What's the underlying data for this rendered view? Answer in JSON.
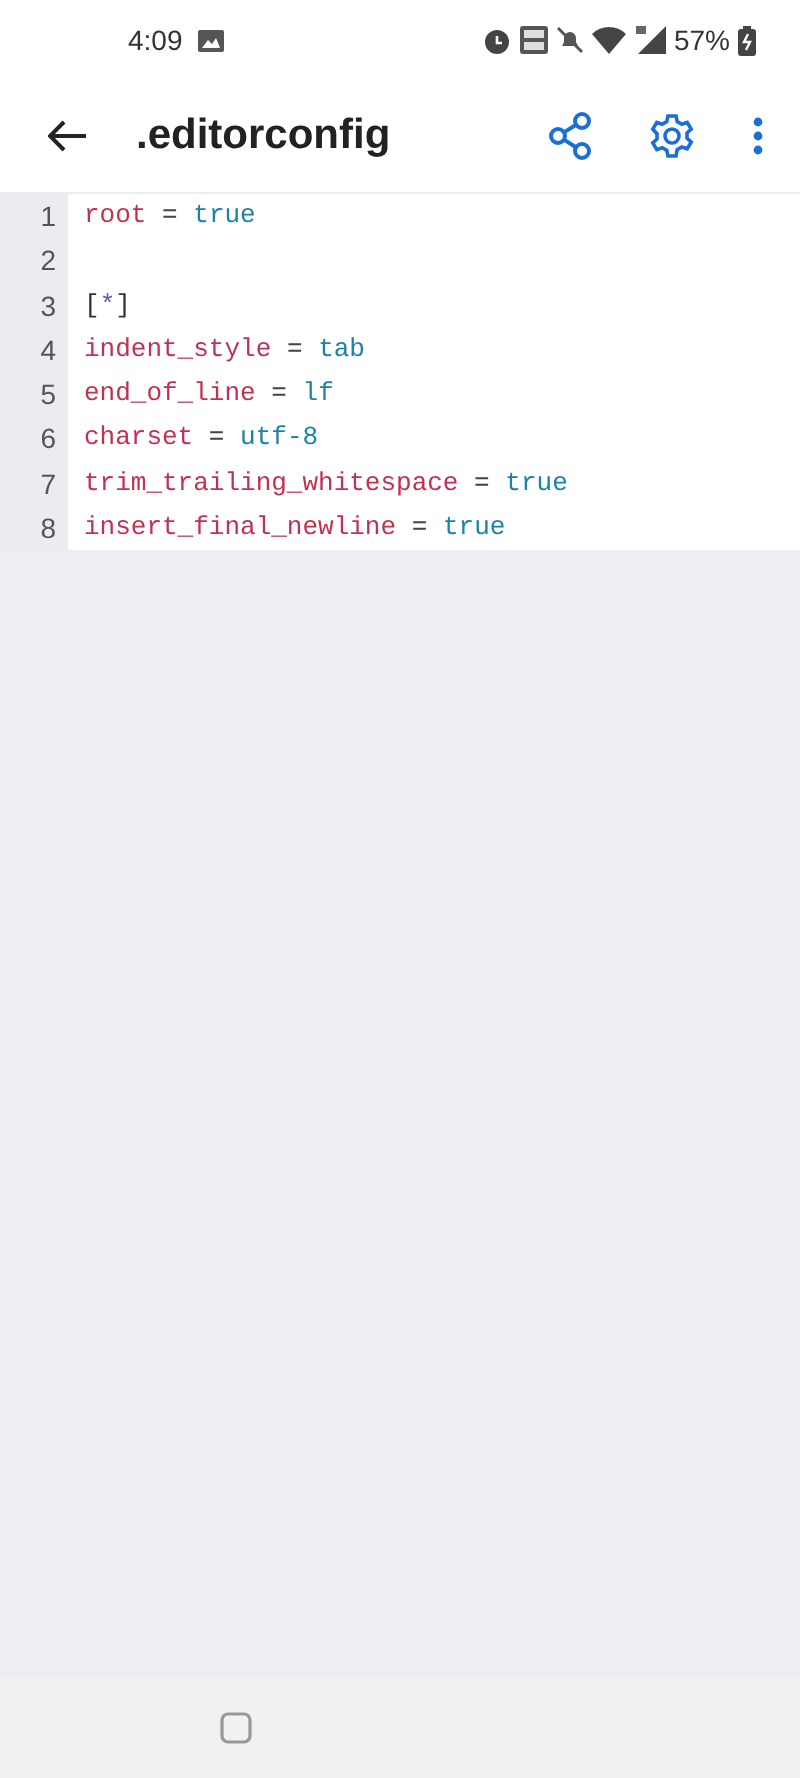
{
  "status_bar": {
    "time": "4:09",
    "battery": "57%"
  },
  "toolbar": {
    "title": ".editorconfig"
  },
  "editor": {
    "lines": [
      {
        "number": "1",
        "tokens": [
          {
            "kind": "key",
            "text": "root"
          },
          {
            "kind": "op",
            "text": "="
          },
          {
            "kind": "value",
            "text": "true"
          }
        ]
      },
      {
        "number": "2"
      },
      {
        "number": "3",
        "tokens": [
          {
            "kind": "bracket",
            "text": "["
          },
          {
            "kind": "glob",
            "text": "*"
          },
          {
            "kind": "bracket",
            "text": "]"
          }
        ]
      },
      {
        "number": "4",
        "tokens": [
          {
            "kind": "key",
            "text": "indent_style"
          },
          {
            "kind": "op",
            "text": "="
          },
          {
            "kind": "value",
            "text": "tab"
          }
        ]
      },
      {
        "number": "5",
        "tokens": [
          {
            "kind": "key",
            "text": "end_of_line"
          },
          {
            "kind": "op",
            "text": "="
          },
          {
            "kind": "value",
            "text": "lf"
          }
        ]
      },
      {
        "number": "6",
        "tokens": [
          {
            "kind": "key",
            "text": "charset"
          },
          {
            "kind": "op",
            "text": "="
          },
          {
            "kind": "value",
            "text": "utf-8"
          }
        ]
      },
      {
        "number": "7",
        "tokens": [
          {
            "kind": "key",
            "text": "trim_trailing_whitespace"
          },
          {
            "kind": "op",
            "text": "="
          },
          {
            "kind": "value",
            "text": "true"
          }
        ]
      },
      {
        "number": "8",
        "tokens": [
          {
            "kind": "key",
            "text": "insert_final_newline"
          },
          {
            "kind": "op",
            "text": "="
          },
          {
            "kind": "value",
            "text": "true"
          }
        ]
      }
    ]
  }
}
